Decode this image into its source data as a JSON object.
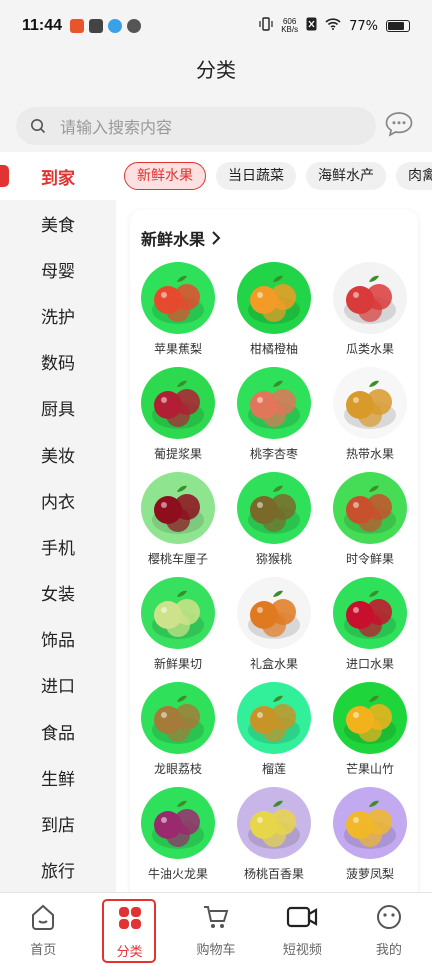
{
  "status_bar": {
    "time": "11:44",
    "net_speed_value": "606",
    "net_speed_unit": "KB/s",
    "battery": "77%"
  },
  "header": {
    "title": "分类"
  },
  "search": {
    "placeholder": "请输入搜索内容"
  },
  "sidebar": {
    "items": [
      {
        "label": "到家",
        "active": true
      },
      {
        "label": "美食"
      },
      {
        "label": "母婴"
      },
      {
        "label": "洗护"
      },
      {
        "label": "数码"
      },
      {
        "label": "厨具"
      },
      {
        "label": "美妆"
      },
      {
        "label": "内衣"
      },
      {
        "label": "手机"
      },
      {
        "label": "女装"
      },
      {
        "label": "饰品"
      },
      {
        "label": "进口"
      },
      {
        "label": "食品"
      },
      {
        "label": "生鲜"
      },
      {
        "label": "到店"
      },
      {
        "label": "旅行"
      }
    ]
  },
  "tabs": [
    {
      "label": "新鲜水果",
      "active": true
    },
    {
      "label": "当日蔬菜"
    },
    {
      "label": "海鲜水产"
    },
    {
      "label": "肉禽"
    }
  ],
  "section": {
    "title": "新鲜水果"
  },
  "products": [
    {
      "label": "苹果蕉梨",
      "bg": "#2fe05a",
      "fg": "#e64a2e"
    },
    {
      "label": "柑橘橙柚",
      "bg": "#22d447",
      "fg": "#f29b26"
    },
    {
      "label": "瓜类水果",
      "bg": "#f3f3f3",
      "fg": "#d93a3a"
    },
    {
      "label": "葡提浆果",
      "bg": "#2dd94f",
      "fg": "#b21f34"
    },
    {
      "label": "桃李杏枣",
      "bg": "#2fe05a",
      "fg": "#e2765a"
    },
    {
      "label": "热带水果",
      "bg": "#f7f7f7",
      "fg": "#d89a2a"
    },
    {
      "label": "樱桃车厘子",
      "bg": "#8fe58f",
      "fg": "#8d0f1e"
    },
    {
      "label": "猕猴桃",
      "bg": "#2fe05a",
      "fg": "#7a6a2a"
    },
    {
      "label": "时令鲜果",
      "bg": "#44dd55",
      "fg": "#c9502d"
    },
    {
      "label": "新鲜果切",
      "bg": "#38e060",
      "fg": "#cde28a"
    },
    {
      "label": "礼盒水果",
      "bg": "#f5f5f5",
      "fg": "#e07a20"
    },
    {
      "label": "进口水果",
      "bg": "#2fe05a",
      "fg": "#c8102e"
    },
    {
      "label": "龙眼荔枝",
      "bg": "#2fe05a",
      "fg": "#a57b3a"
    },
    {
      "label": "榴莲",
      "bg": "#32f09a",
      "fg": "#c79428"
    },
    {
      "label": "芒果山竹",
      "bg": "#1fd53c",
      "fg": "#f2b21d"
    },
    {
      "label": "牛油火龙果",
      "bg": "#2fe05a",
      "fg": "#9a2a6e"
    },
    {
      "label": "杨桃百香果",
      "bg": "#c9b6e8",
      "fg": "#e7d54a"
    },
    {
      "label": "菠萝凤梨",
      "bg": "#c2a9f0",
      "fg": "#f0b82a"
    }
  ],
  "bottom_nav": [
    {
      "label": "首页",
      "icon": "home-icon"
    },
    {
      "label": "分类",
      "icon": "grid-icon",
      "active": true
    },
    {
      "label": "购物车",
      "icon": "cart-icon"
    },
    {
      "label": "短视频",
      "icon": "video-icon"
    },
    {
      "label": "我的",
      "icon": "profile-icon"
    }
  ],
  "colors": {
    "accent": "#e23232"
  }
}
